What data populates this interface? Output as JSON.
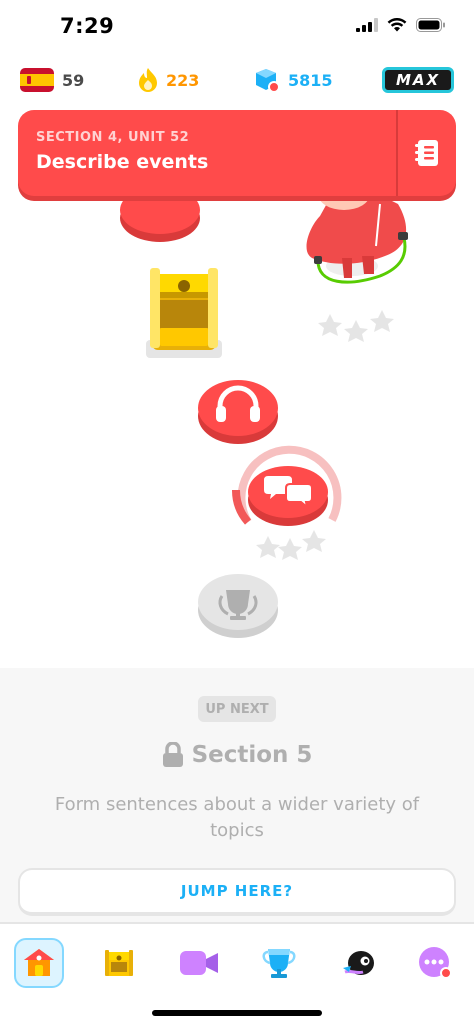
{
  "status_bar": {
    "time": "7:29"
  },
  "stats": {
    "language_flag": "spain-flag-icon",
    "language_count": "59",
    "streak": "223",
    "gems": "5815",
    "badge": "MAX"
  },
  "unit": {
    "subtitle": "SECTION 4, UNIT 52",
    "title": "Describe events"
  },
  "path_nodes": [
    {
      "type": "video-lesson",
      "state": "completed"
    },
    {
      "type": "treasure-chest",
      "state": "opened"
    },
    {
      "type": "listening-lesson",
      "state": "completed"
    },
    {
      "type": "conversation-lesson",
      "state": "current"
    },
    {
      "type": "unit-trophy",
      "state": "locked"
    }
  ],
  "up_next": {
    "label": "UP NEXT",
    "section_title": "Section 5",
    "description": "Form sentences about a wider variety of topics",
    "jump_button": "JUMP HERE?"
  },
  "tabs": [
    {
      "name": "learn",
      "icon": "home-icon",
      "active": true
    },
    {
      "name": "quests",
      "icon": "treasure-icon",
      "active": false
    },
    {
      "name": "video",
      "icon": "video-camera-icon",
      "active": false
    },
    {
      "name": "leagues",
      "icon": "trophy-icon",
      "active": false
    },
    {
      "name": "stories",
      "icon": "character-icon",
      "active": false
    },
    {
      "name": "more",
      "icon": "more-icon",
      "active": false
    }
  ],
  "colors": {
    "unit_red": "#ff4b4b",
    "unit_red_dark": "#e03e3e",
    "streak_orange": "#ff9600",
    "gem_blue": "#1cb0f6",
    "locked_gray": "#afafaf"
  }
}
